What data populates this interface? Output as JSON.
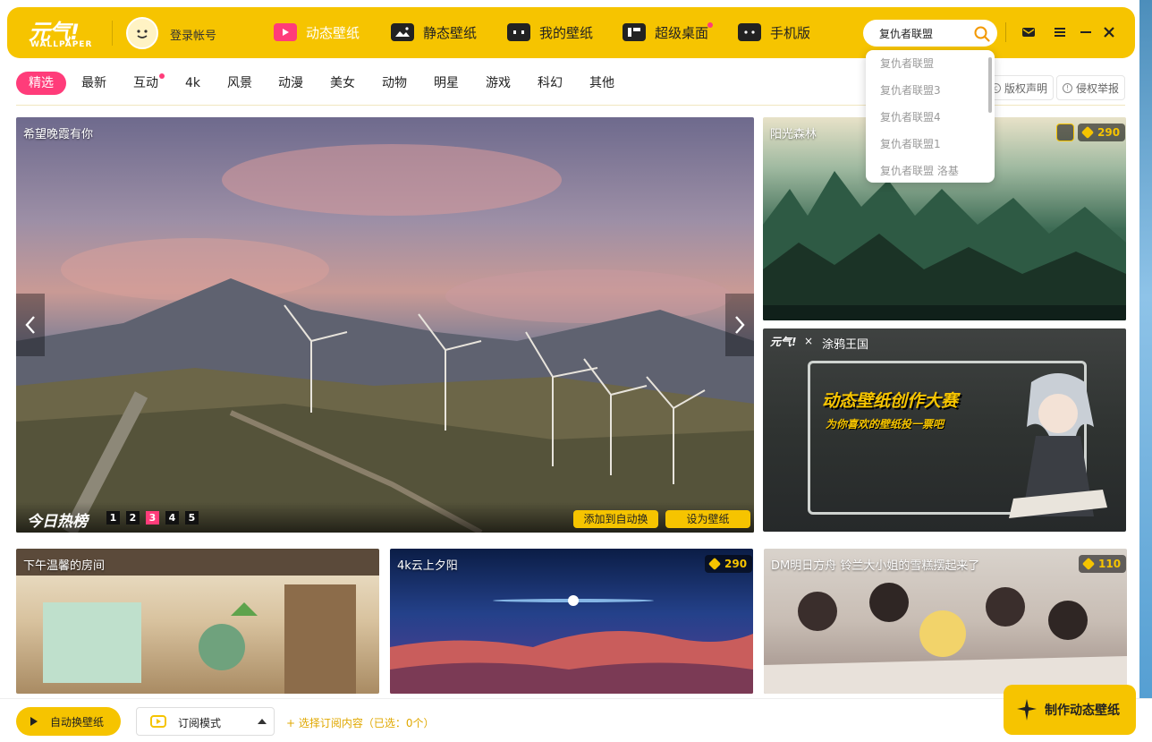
{
  "app": {
    "logo_text": "元气!",
    "logo_sub": "WALLPAPER",
    "login_label": "登录帐号"
  },
  "nav": [
    {
      "label": "动态壁纸",
      "active": true
    },
    {
      "label": "静态壁纸",
      "active": false
    },
    {
      "label": "我的壁纸",
      "active": false
    },
    {
      "label": "超级桌面",
      "active": false,
      "has_dot": true
    },
    {
      "label": "手机版",
      "active": false
    }
  ],
  "search": {
    "value": "复仇者联盟",
    "suggestions": [
      "复仇者联盟",
      "复仇者联盟3",
      "复仇者联盟4",
      "复仇者联盟1",
      "复仇者联盟 洛基"
    ]
  },
  "categories": [
    {
      "label": "精选",
      "active": true
    },
    {
      "label": "最新"
    },
    {
      "label": "互动",
      "has_dot": true
    },
    {
      "label": "4k"
    },
    {
      "label": "风景"
    },
    {
      "label": "动漫"
    },
    {
      "label": "美女"
    },
    {
      "label": "动物"
    },
    {
      "label": "明星"
    },
    {
      "label": "游戏"
    },
    {
      "label": "科幻"
    },
    {
      "label": "其他"
    }
  ],
  "legal": {
    "copyright": "版权声明",
    "report": "侵权举报"
  },
  "featured": {
    "title": "希望晚霞有你",
    "hot_title": "今日热榜",
    "pages": [
      "1",
      "2",
      "3",
      "4",
      "5"
    ],
    "active_page": 3,
    "add_auto": "添加到自动换",
    "set_wallpaper": "设为壁纸"
  },
  "cards": {
    "forest": {
      "title": "阳光森林",
      "count": "290"
    },
    "contest": {
      "partner": "涂鸦王国",
      "headline": "动态壁纸创作大赛",
      "subline": "为你喜欢的壁纸投一票吧"
    },
    "room": {
      "title": "下午温馨的房间"
    },
    "sunset": {
      "title": "4k云上夕阳",
      "count": "290"
    },
    "arknights": {
      "title": "DM明日方舟 铃兰大小姐的雪糕摆起来了",
      "count": "110"
    }
  },
  "bottom": {
    "auto_switch": "自动换壁纸",
    "subscribe_mode": "订阅模式",
    "select_sub": "+ 选择订阅内容（已选：0个）",
    "make": "制作动态壁纸"
  },
  "colors": {
    "brand_yellow": "#f6c400",
    "accent_pink": "#ff3c7a"
  }
}
